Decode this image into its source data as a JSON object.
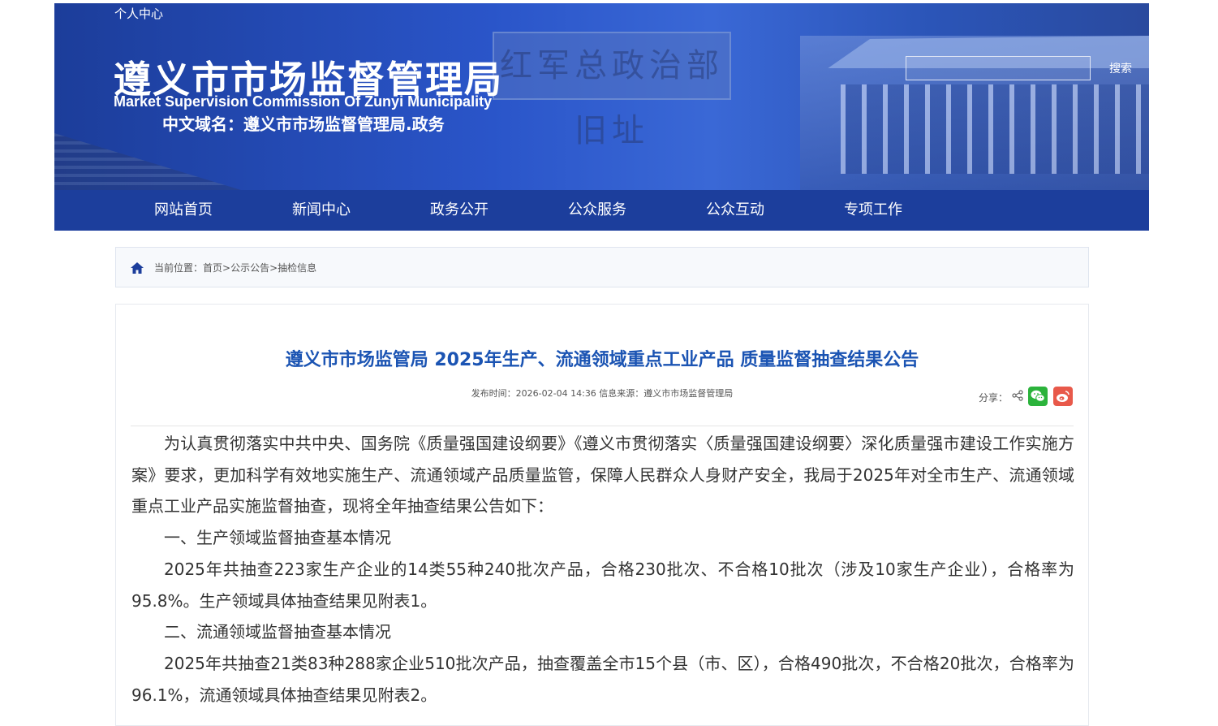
{
  "header": {
    "personal_center": "个人中心",
    "title": "遵义市市场监督管理局",
    "title_en": "Market Supervision Commission Of Zunyi Municipality",
    "domain": "中文域名：遵义市市场监督管理局.政务",
    "plaque_text": "红军总政治部旧址",
    "search": {
      "placeholder": "",
      "button_label": "搜索"
    }
  },
  "nav": {
    "items": [
      {
        "label": "网站首页"
      },
      {
        "label": "新闻中心"
      },
      {
        "label": "政务公开"
      },
      {
        "label": "公众服务"
      },
      {
        "label": "公众互动"
      },
      {
        "label": "专项工作"
      }
    ]
  },
  "breadcrumb": {
    "prefix": "当前位置：",
    "items": [
      {
        "label": "首页"
      },
      {
        "label": "公示公告"
      },
      {
        "label": "抽检信息"
      }
    ],
    "separator": ">"
  },
  "article": {
    "title": "遵义市市场监管局 2025年生产、流通领域重点工业产品 质量监督抽查结果公告",
    "meta": "发布时间：2026-02-04 14:36 信息来源：遵义市市场监督管理局",
    "share_label": "分享：",
    "paragraphs": [
      "为认真贯彻落实中共中央、国务院《质量强国建设纲要》《遵义市贯彻落实〈质量强国建设纲要〉深化质量强市建设工作实施方案》要求，更加科学有效地实施生产、流通领域产品质量监管，保障人民群众人身财产安全，我局于2025年对全市生产、流通领域重点工业产品实施监督抽查，现将全年抽查结果公告如下：",
      "一、生产领域监督抽查基本情况",
      "2025年共抽查223家生产企业的14类55种240批次产品，合格230批次、不合格10批次（涉及10家生产企业），合格率为95.8%。生产领域具体抽查结果见附表1。",
      "二、流通领域监督抽查基本情况",
      "2025年共抽查21类83种288家企业510批次产品，抽查覆盖全市15个县（市、区），合格490批次，不合格20批次，合格率为96.1%，流通领域具体抽查结果见附表2。"
    ]
  },
  "colors": {
    "banner": "#2a55c9",
    "nav": "#1c3e9c",
    "title": "#1b54b3",
    "wechat": "#2bb33b",
    "weibo": "#e8594a"
  }
}
